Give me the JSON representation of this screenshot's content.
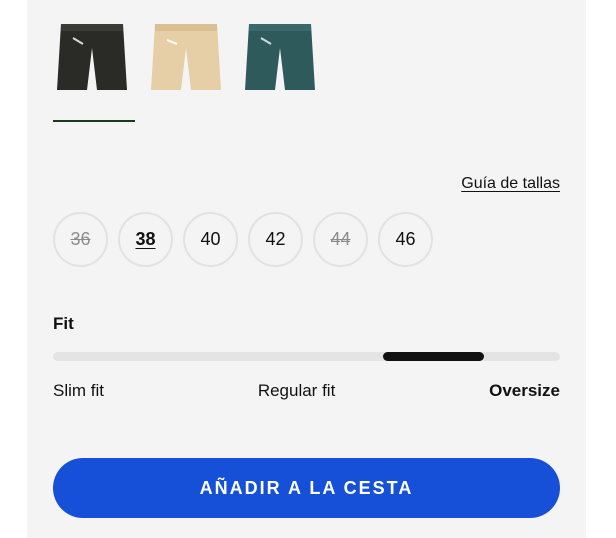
{
  "products": {
    "variants": [
      {
        "name": "black-denim",
        "color": "#2a2a26",
        "selected": true
      },
      {
        "name": "beige-denim",
        "color": "#e6cfa6",
        "selected": false
      },
      {
        "name": "blue-green-denim",
        "color": "#2f5a5c",
        "selected": false
      }
    ]
  },
  "size_guide_label": "Guía de tallas",
  "sizes": [
    {
      "label": "36",
      "available": false,
      "selected": false
    },
    {
      "label": "38",
      "available": true,
      "selected": true
    },
    {
      "label": "40",
      "available": true,
      "selected": false
    },
    {
      "label": "42",
      "available": true,
      "selected": false
    },
    {
      "label": "44",
      "available": false,
      "selected": false
    },
    {
      "label": "46",
      "available": true,
      "selected": false
    }
  ],
  "fit": {
    "title": "Fit",
    "options": [
      "Slim fit",
      "Regular fit",
      "Oversize"
    ],
    "selected": "Oversize",
    "indicator_start": 0.65,
    "indicator_end": 0.85
  },
  "cta": {
    "label": "AÑADIR A LA CESTA",
    "color": "#1650d8"
  }
}
